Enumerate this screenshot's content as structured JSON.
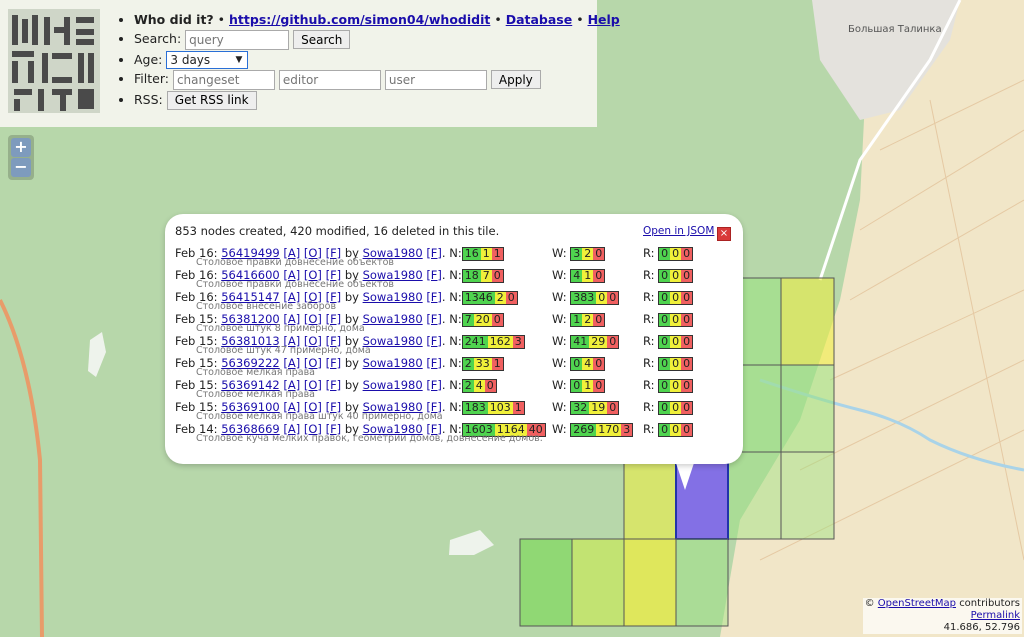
{
  "header": {
    "title": "Who did it?",
    "repo_link": "https://github.com/simon04/whodidit",
    "database_link": "Database",
    "help_link": "Help",
    "separator": "•",
    "search_label": "Search:",
    "search_placeholder": "query",
    "search_button": "Search",
    "age_label": "Age:",
    "age_value": "3 days",
    "filter_label": "Filter:",
    "filter_changeset_placeholder": "changeset",
    "filter_editor_placeholder": "editor",
    "filter_user_placeholder": "user",
    "apply_button": "Apply",
    "rss_label": "RSS:",
    "rss_button": "Get RSS link"
  },
  "zoom": {
    "in": "+",
    "out": "−"
  },
  "map": {
    "place_label": "Большая Талинка"
  },
  "popup": {
    "summary": "853 nodes created, 420 modified, 16 deleted in this tile.",
    "josm_link": "Open in JSOM",
    "close": "×",
    "rows": [
      {
        "date": "Feb 16:",
        "cs": "56419499",
        "a": "[A]",
        "o": "[O]",
        "f": "[F]",
        "by": "by",
        "user": "Sowa1980",
        "uf": "[F]",
        "dotn": ". N:",
        "n": [
          "16",
          "1",
          "1"
        ],
        "w": [
          "3",
          "2",
          "0"
        ],
        "r": [
          "0",
          "0",
          "0"
        ],
        "comment": "Столовое правки довнесение объектов"
      },
      {
        "date": "Feb 16:",
        "cs": "56416600",
        "a": "[A]",
        "o": "[O]",
        "f": "[F]",
        "by": "by",
        "user": "Sowa1980",
        "uf": "[F]",
        "dotn": ". N:",
        "n": [
          "18",
          "7",
          "0"
        ],
        "w": [
          "4",
          "1",
          "0"
        ],
        "r": [
          "0",
          "0",
          "0"
        ],
        "comment": "Столовое правки довнесение объектов"
      },
      {
        "date": "Feb 16:",
        "cs": "56415147",
        "a": "[A]",
        "o": "[O]",
        "f": "[F]",
        "by": "by",
        "user": "Sowa1980",
        "uf": "[F]",
        "dotn": ". N:",
        "n": [
          "1346",
          "2",
          "0"
        ],
        "w": [
          "383",
          "0",
          "0"
        ],
        "r": [
          "0",
          "0",
          "0"
        ],
        "comment": "Столовое внесение заборов"
      },
      {
        "date": "Feb 15:",
        "cs": "56381200",
        "a": "[A]",
        "o": "[O]",
        "f": "[F]",
        "by": "by",
        "user": "Sowa1980",
        "uf": "[F]",
        "dotn": ". N:",
        "n": [
          "7",
          "20",
          "0"
        ],
        "w": [
          "1",
          "2",
          "0"
        ],
        "r": [
          "0",
          "0",
          "0"
        ],
        "comment": "Столовое штук 8 примерно, дома"
      },
      {
        "date": "Feb 15:",
        "cs": "56381013",
        "a": "[A]",
        "o": "[O]",
        "f": "[F]",
        "by": "by",
        "user": "Sowa1980",
        "uf": "[F]",
        "dotn": ". N:",
        "n": [
          "241",
          "162",
          "3"
        ],
        "w": [
          "41",
          "29",
          "0"
        ],
        "r": [
          "0",
          "0",
          "0"
        ],
        "comment": "Столовое штук 47 примерно, дома"
      },
      {
        "date": "Feb 15:",
        "cs": "56369222",
        "a": "[A]",
        "o": "[O]",
        "f": "[F]",
        "by": "by",
        "user": "Sowa1980",
        "uf": "[F]",
        "dotn": ". N:",
        "n": [
          "2",
          "33",
          "1"
        ],
        "w": [
          "0",
          "4",
          "0"
        ],
        "r": [
          "0",
          "0",
          "0"
        ],
        "comment": "Столовое мелкая права"
      },
      {
        "date": "Feb 15:",
        "cs": "56369142",
        "a": "[A]",
        "o": "[O]",
        "f": "[F]",
        "by": "by",
        "user": "Sowa1980",
        "uf": "[F]",
        "dotn": ". N:",
        "n": [
          "2",
          "4",
          "0"
        ],
        "w": [
          "0",
          "1",
          "0"
        ],
        "r": [
          "0",
          "0",
          "0"
        ],
        "comment": "Столовое мелкая права"
      },
      {
        "date": "Feb 15:",
        "cs": "56369100",
        "a": "[A]",
        "o": "[O]",
        "f": "[F]",
        "by": "by",
        "user": "Sowa1980",
        "uf": "[F]",
        "dotn": ". N:",
        "n": [
          "183",
          "103",
          "1"
        ],
        "w": [
          "32",
          "19",
          "0"
        ],
        "r": [
          "0",
          "0",
          "0"
        ],
        "comment": "Столовое мелкая права штук 40 примерно, дома"
      },
      {
        "date": "Feb 14:",
        "cs": "56368669",
        "a": "[A]",
        "o": "[O]",
        "f": "[F]",
        "by": "by",
        "user": "Sowa1980",
        "uf": "[F]",
        "dotn": ". N:",
        "n": [
          "1603",
          "1164",
          "40"
        ],
        "w": [
          "269",
          "170",
          "3"
        ],
        "r": [
          "0",
          "0",
          "0"
        ],
        "comment": "Столовое куча мелких правок, геометрии домов, довнесение домов."
      }
    ]
  },
  "labels": {
    "w": "W:",
    "r": "R:"
  },
  "attribution": {
    "prefix": "©",
    "osm_link": "OpenStreetMap",
    "suffix": "contributors",
    "permalink": "Permalink",
    "coords": "41.686, 52.796"
  },
  "colors": {
    "created": "#4fd44f",
    "modified": "#f0f03a",
    "deleted": "#f06060",
    "forest": "#b5d6a8",
    "farmland": "#f3e7c9"
  }
}
